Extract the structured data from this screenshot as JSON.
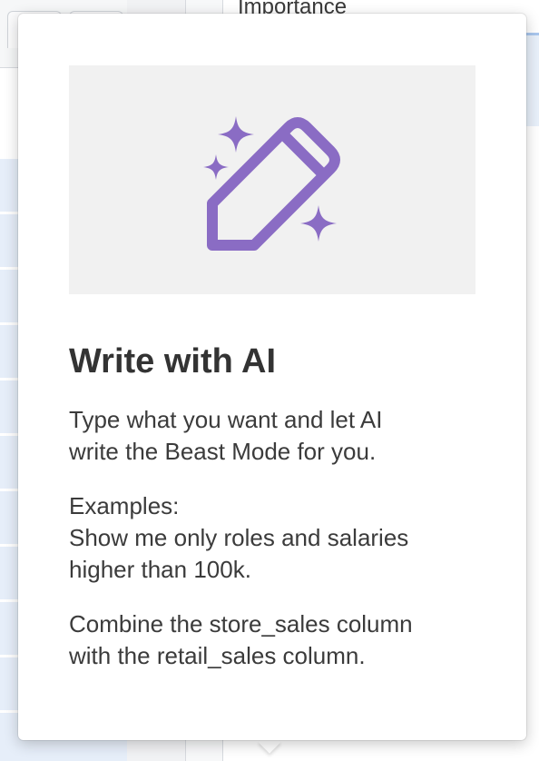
{
  "background": {
    "main_title": "Importance"
  },
  "popover": {
    "illustration_icon": "ai-pencil-sparkles-icon",
    "accent_color": "#8a6cc4",
    "title": "Write with AI",
    "description_lines": [
      "Type what you want and let AI",
      "write the Beast Mode for you."
    ],
    "examples_lines": [
      "Examples:",
      "Show me only roles and salaries",
      "higher than 100k."
    ],
    "example2_lines": [
      "Combine the store_sales column",
      "with the retail_sales column."
    ]
  }
}
